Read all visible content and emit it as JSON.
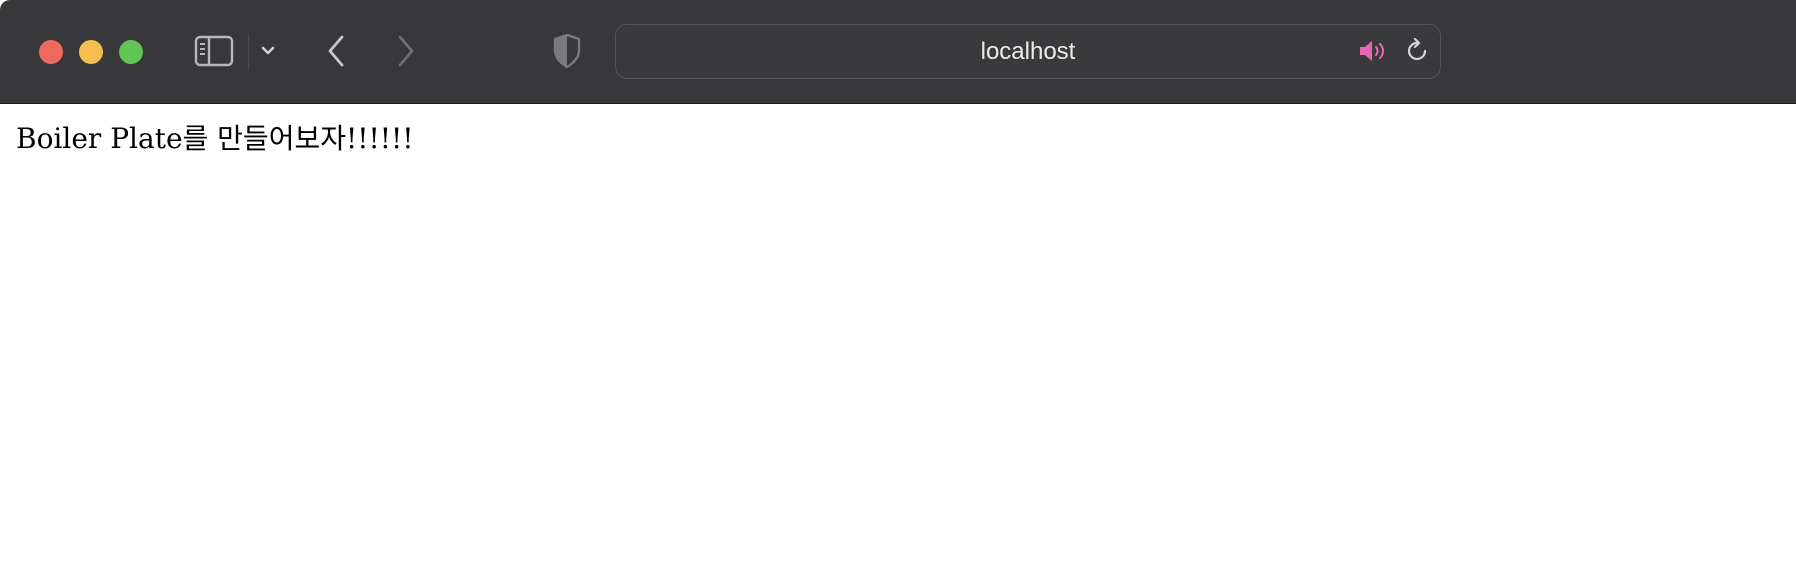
{
  "browser": {
    "address_bar": {
      "url_text": "localhost"
    },
    "icons": {
      "sidebar": "sidebar-icon",
      "sidebar_menu": "chevron-down-icon",
      "back": "chevron-left-icon",
      "forward": "chevron-right-icon",
      "privacy": "shield-icon",
      "audio": "speaker-icon",
      "reload": "reload-icon"
    },
    "colors": {
      "toolbar": "#38383b",
      "close": "#ee6a5f",
      "minimize": "#f5be4f",
      "maximize": "#61c554",
      "audio_accent": "#e667b5"
    }
  },
  "page": {
    "headline": "Boiler Plate를 만들어보자!!!!!!"
  }
}
